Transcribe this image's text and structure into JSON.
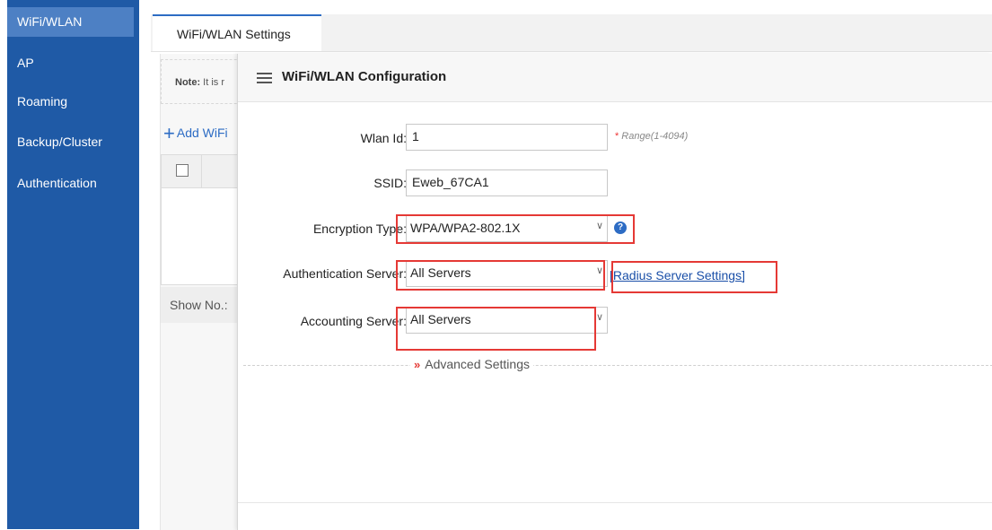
{
  "sidebar": {
    "items": [
      {
        "label": "WiFi/WLAN"
      },
      {
        "label": "AP"
      },
      {
        "label": "Roaming"
      },
      {
        "label": "Backup/Cluster"
      },
      {
        "label": "Authentication"
      }
    ]
  },
  "tabs": [
    {
      "label": "WiFi/WLAN Settings"
    }
  ],
  "background": {
    "note_prefix": "Note:",
    "note_text": "It is r",
    "add_wifi_label": "Add WiFi",
    "show_no_label": "Show No.:"
  },
  "dialog": {
    "title": "WiFi/WLAN Configuration",
    "wlan_id": {
      "label": "Wlan Id:",
      "value": "1",
      "hint": "Range(1-4094)"
    },
    "ssid": {
      "label": "SSID:",
      "value": "Eweb_67CA1"
    },
    "encryption": {
      "label": "Encryption Type:",
      "value": "WPA/WPA2-802.1X"
    },
    "auth_server": {
      "label": "Authentication Server:",
      "value": "All Servers",
      "link": "[Radius Server Settings]"
    },
    "acct_server": {
      "label": "Accounting Server:",
      "value": "All Servers"
    },
    "advanced_label": "Advanced Settings"
  },
  "colors": {
    "sidebar_bg": "#1f5aa6",
    "sidebar_active": "#4d80c4",
    "accent": "#2d6cc4",
    "highlight_box": "#e53935"
  },
  "icons": {
    "menu": "hamburger-menu-icon",
    "help": "question-circle-icon",
    "add": "plus-icon",
    "advanced": "double-chevron-right-icon",
    "dropdown": "chevron-down-icon"
  }
}
